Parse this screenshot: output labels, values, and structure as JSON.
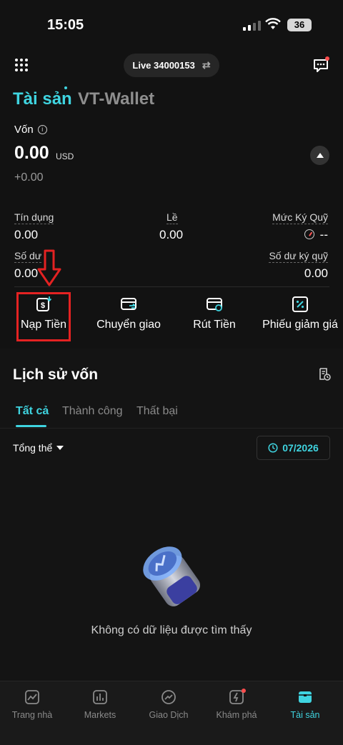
{
  "status_bar": {
    "time": "15:05",
    "battery": "36"
  },
  "header": {
    "account_label": "Live 34000153"
  },
  "titles": {
    "main": "Tài sản",
    "secondary": "VT-Wallet"
  },
  "equity": {
    "label": "Vốn",
    "value": "0.00",
    "unit": "USD",
    "change": "+0.00"
  },
  "stats": {
    "credit_label": "Tín dụng",
    "credit_value": "0.00",
    "margin_label": "Lề",
    "margin_value": "0.00",
    "margin_level_label": "Mức Ký Quỹ",
    "margin_level_value": "--",
    "balance_label": "Số dư",
    "balance_value": "0.00",
    "deposit_balance_label": "Số dư ký quỹ",
    "deposit_balance_value": "0.00"
  },
  "actions": [
    {
      "label": "Nạp Tiền",
      "icon": "deposit-icon"
    },
    {
      "label": "Chuyển giao",
      "icon": "transfer-icon"
    },
    {
      "label": "Rút Tiền",
      "icon": "withdraw-icon"
    },
    {
      "label": "Phiếu giảm giá",
      "icon": "coupon-icon"
    }
  ],
  "history": {
    "title": "Lịch sử vốn",
    "tabs": [
      "Tất cả",
      "Thành công",
      "Thất bại"
    ],
    "active_tab": 0,
    "filter_label": "Tổng thể",
    "date_filter": "07/2026",
    "empty_text": "Không có dữ liệu được tìm thấy"
  },
  "bottom_nav": [
    {
      "label": "Trang nhà",
      "icon": "home-chart-icon"
    },
    {
      "label": "Markets",
      "icon": "markets-icon"
    },
    {
      "label": "Giao Dịch",
      "icon": "trade-icon"
    },
    {
      "label": "Khám phá",
      "icon": "explore-icon"
    },
    {
      "label": "Tài sản",
      "icon": "assets-icon"
    }
  ],
  "colors": {
    "accent": "#3fd4e0",
    "highlight": "#e42222",
    "background": "#121212"
  }
}
